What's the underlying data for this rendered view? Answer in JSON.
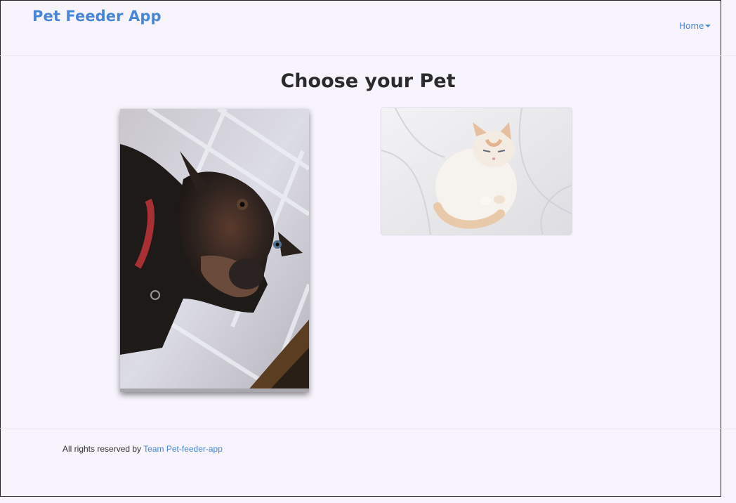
{
  "navbar": {
    "brand": "Pet Feeder App",
    "home_label": "Home"
  },
  "main": {
    "title": "Choose your Pet",
    "pets": [
      {
        "name": "dog",
        "image_icon": "dog-photo"
      },
      {
        "name": "cat",
        "image_icon": "cat-photo"
      }
    ]
  },
  "footer": {
    "text": "All rights reserved by ",
    "link_label": "Team Pet-feeder-app"
  },
  "colors": {
    "accent": "#4a86d8",
    "background": "#f7f4fd",
    "title": "#2b2b2b"
  }
}
